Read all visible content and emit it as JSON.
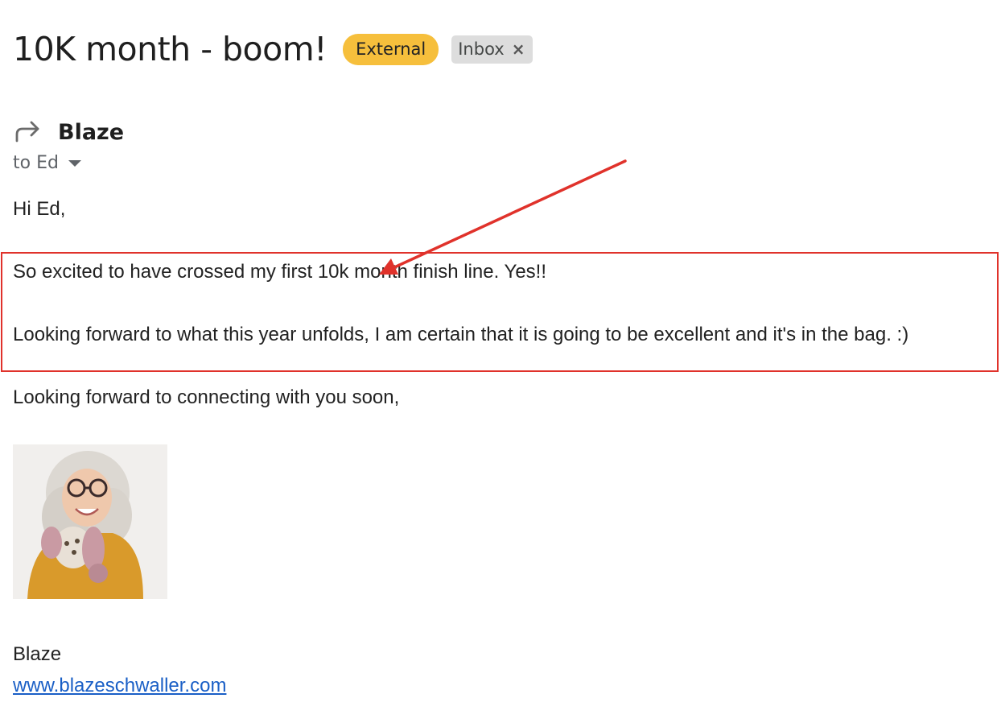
{
  "email": {
    "subject": "10K month - boom!",
    "labels": {
      "external": "External",
      "inbox": "Inbox",
      "remove_glyph": "×"
    },
    "sender": "Blaze",
    "recipient_line": "to Ed",
    "body": {
      "greeting": "Hi Ed,",
      "para1": "So excited to have crossed my first 10k month finish line. Yes!!",
      "para2": "Looking forward to what this year unfolds, I am certain that it is going to be excellent and it's in the bag. :)",
      "closing": "Looking forward to connecting with you soon,"
    },
    "signature": {
      "name": "Blaze",
      "website": "www.blazeschwaller.com"
    }
  },
  "icons": {
    "forward": "forward-arrow-icon",
    "caret": "chevron-down-icon",
    "remove": "close-icon"
  },
  "colors": {
    "external_label": "#f6bf3c",
    "inbox_label": "#dddddd",
    "annotation": "#e0322b",
    "link": "#1a5fc6"
  }
}
